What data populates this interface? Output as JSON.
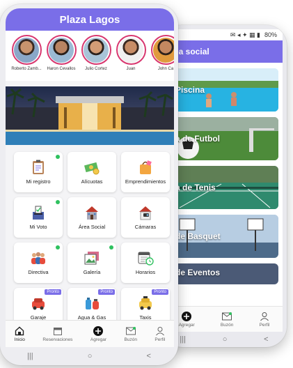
{
  "back": {
    "status_battery": "80%",
    "header_title": "ea social",
    "areas": [
      {
        "label": "Piscina"
      },
      {
        "label": "a de Futbol"
      },
      {
        "label": "a de Tenis"
      },
      {
        "label": "de Basquet"
      },
      {
        "label": "de Eventos"
      }
    ],
    "tabs": [
      {
        "label": "Agregar",
        "icon": "plus-icon"
      },
      {
        "label": "Buzón",
        "icon": "mail-icon"
      },
      {
        "label": "Perfil",
        "icon": "user-icon"
      }
    ]
  },
  "front": {
    "title": "Plaza Lagos",
    "residents": [
      {
        "name": "Roberto Zamb..."
      },
      {
        "name": "Haron Cevallos"
      },
      {
        "name": "Julio Cortez"
      },
      {
        "name": "Juan"
      },
      {
        "name": "John Ca"
      }
    ],
    "tiles": [
      {
        "label": "Mi registro",
        "icon": "clipboard-icon",
        "badge": "dot"
      },
      {
        "label": "Alícuotas",
        "icon": "money-icon",
        "badge": ""
      },
      {
        "label": "Emprendimientos",
        "icon": "shopping-bag-icon",
        "badge": ""
      },
      {
        "label": "Mi Voto",
        "icon": "ballot-icon",
        "badge": "dot"
      },
      {
        "label": "Área Social",
        "icon": "building-icon",
        "badge": ""
      },
      {
        "label": "Cámaras",
        "icon": "camera-icon",
        "badge": ""
      },
      {
        "label": "Directiva",
        "icon": "people-icon",
        "badge": "dot"
      },
      {
        "label": "Galería",
        "icon": "gallery-icon",
        "badge": "dot"
      },
      {
        "label": "Horarios",
        "icon": "calendar-icon",
        "badge": ""
      },
      {
        "label": "Garaje",
        "icon": "garage-icon",
        "badge": "Pronto"
      },
      {
        "label": "Agua & Gas",
        "icon": "water-gas-icon",
        "badge": "Pronto"
      },
      {
        "label": "Taxis",
        "icon": "taxi-icon",
        "badge": "Pronto"
      }
    ],
    "tabs": [
      {
        "label": "Inicio",
        "icon": "home-icon"
      },
      {
        "label": "Reservaciones",
        "icon": "calendar-icon"
      },
      {
        "label": "Agregar",
        "icon": "plus-icon"
      },
      {
        "label": "Buzón",
        "icon": "mail-icon"
      },
      {
        "label": "Perfil",
        "icon": "user-icon"
      }
    ],
    "nav": [
      "|||",
      "○",
      "<"
    ]
  },
  "colors": {
    "accent": "#7a6ee8",
    "badge_green": "#2fc15f",
    "avatar_ring": "#d8376f"
  }
}
